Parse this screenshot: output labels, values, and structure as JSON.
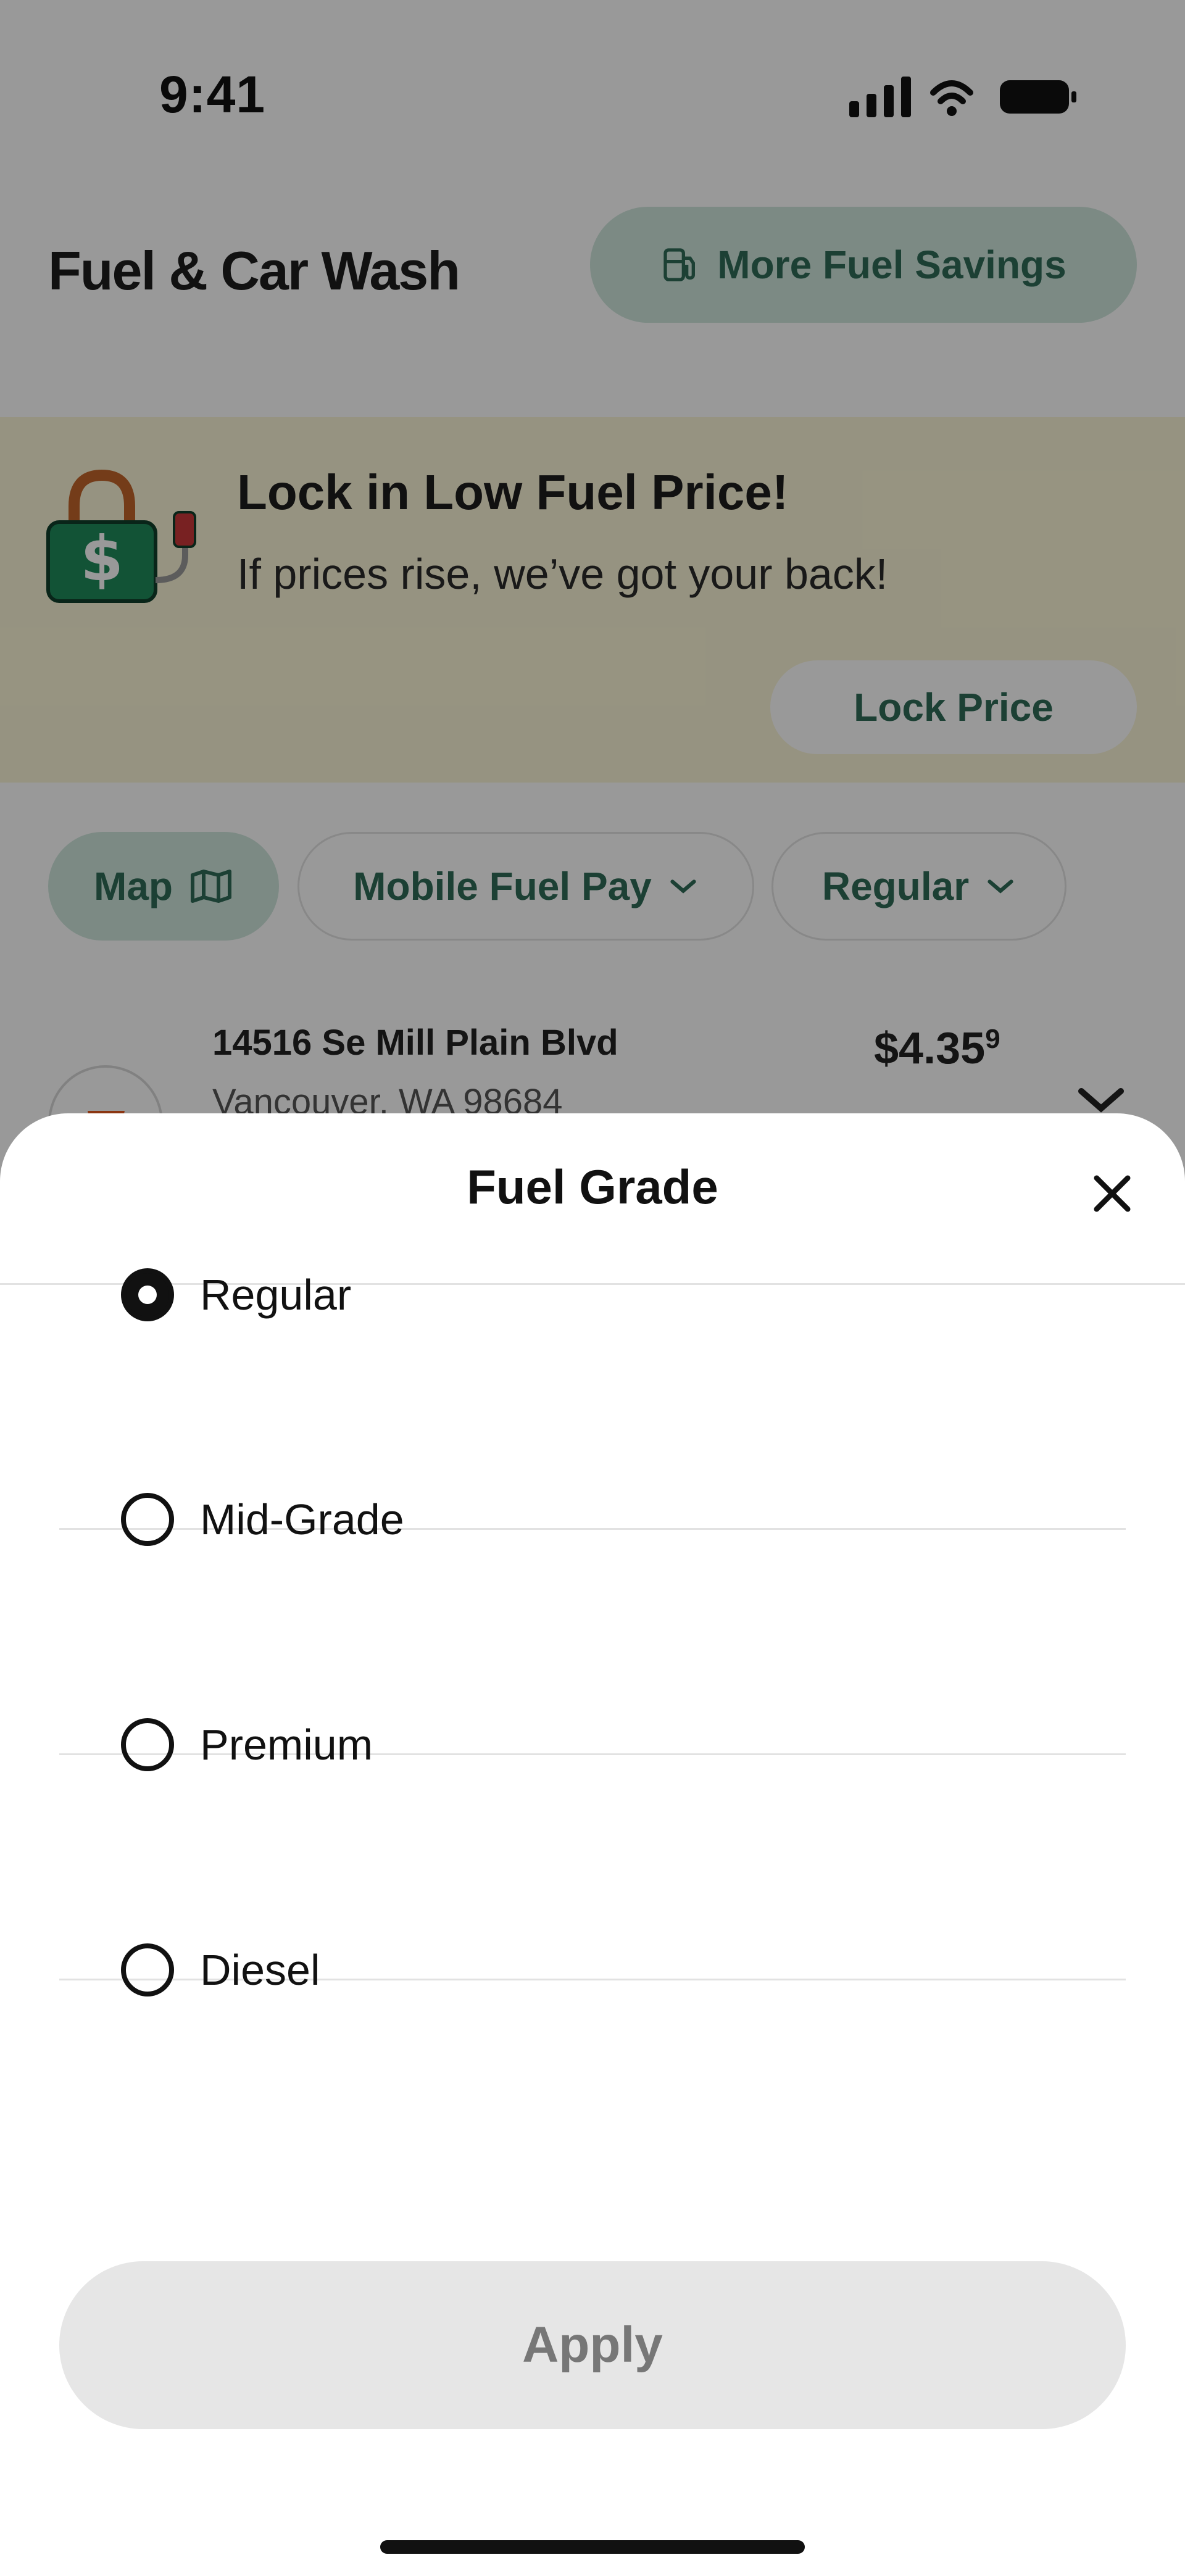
{
  "status_bar": {
    "time": "9:41"
  },
  "header": {
    "title": "Fuel & Car Wash",
    "savings_button": "More Fuel Savings"
  },
  "promo": {
    "title": "Lock in Low Fuel Price!",
    "subtitle": "If prices rise, we’ve got your back!",
    "button": "Lock Price"
  },
  "filters": {
    "map": "Map",
    "payment": "Mobile Fuel Pay",
    "grade": "Regular"
  },
  "station": {
    "address": "14516 Se Mill Plain Blvd",
    "city": "Vancouver, WA 98684",
    "price_main": "$4.35",
    "price_sup": "9"
  },
  "sheet": {
    "title": "Fuel Grade",
    "options": [
      {
        "label": "Regular",
        "selected": true
      },
      {
        "label": "Mid-Grade",
        "selected": false
      },
      {
        "label": "Premium",
        "selected": false
      },
      {
        "label": "Diesel",
        "selected": false
      }
    ],
    "apply": "Apply"
  },
  "colors": {
    "accent_green": "#2f6b58",
    "chip_green": "#cfe6dd",
    "promo_bg": "#fbf6d7"
  }
}
